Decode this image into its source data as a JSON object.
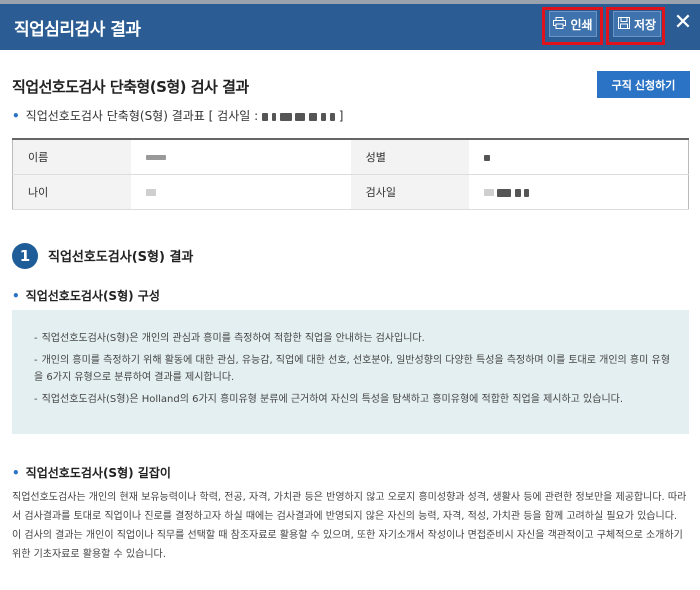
{
  "header": {
    "title": "직업심리검사 결과",
    "print_label": "인쇄",
    "save_label": "저장",
    "close_glyph": "✕"
  },
  "page": {
    "title": "직업선호도검사 단축형(S형) 검사 결과",
    "apply_label": "구직 신청하기",
    "result_table_prefix": "직업선호도검사 단축형(S형) 결과표 [ 검사일 :",
    "result_table_suffix": "]"
  },
  "info_table": {
    "name_label": "이름",
    "gender_label": "성별",
    "age_label": "나이",
    "testdate_label": "검사일"
  },
  "section1": {
    "number": "1",
    "title": "직업선호도검사(S형) 결과",
    "composition_title": "직업선호도검사(S형) 구성",
    "items": [
      "직업선호도검사(S형)은 개인의 관심과 흥미를 측정하여 적합한 직업을 안내하는 검사입니다.",
      "개인의 흥미를 측정하기 위해 활동에 대한 관심, 유능감, 직업에 대한 선호, 선호분야, 일반성향의 다양한 특성을 측정하며 이를 토대로 개인의 흥미 유형을 6가지 유형으로 분류하여 결과를 제시합니다.",
      "직업선호도검사(S형)은 Holland의 6가지 흥미유형 분류에 근거하여 자신의 특성을 탐색하고 흥미유형에 적합한 직업을 제시하고 있습니다."
    ],
    "guide_title": "직업선호도검사(S형) 길잡이",
    "guide_para1": "직업선호도검사는 개인의 현재 보유능력이나 학력, 전공, 자격, 가치관 등은 반영하지 않고 오로지 흥미성향과 성격, 생활사 등에 관련한 정보만을 제공합니다. 따라서 검사결과를 토대로 직업이나 진로를 결정하고자 하실 때에는 검사결과에 반영되지 않은 자신의 능력, 자격, 적성, 가치관 등을 함께 고려하실 필요가 있습니다.",
    "guide_para2": "이 검사의 결과는 개인이 직업이나 직무를 선택할 때 참조자료로 활용할 수 있으며, 또한 자기소개서 작성이나 면접준비시 자신을 객관적이고 구체적으로 소개하기 위한 기초자료로 활용할 수 있습니다."
  },
  "colors": {
    "header_bg": "#2b5d94",
    "accent": "#2b73c4",
    "highlight_box": "#e0131d",
    "desc_bg": "#e4eff1"
  },
  "icons": {
    "print": "printer-icon",
    "save": "floppy-disk-icon",
    "close": "close-icon"
  }
}
